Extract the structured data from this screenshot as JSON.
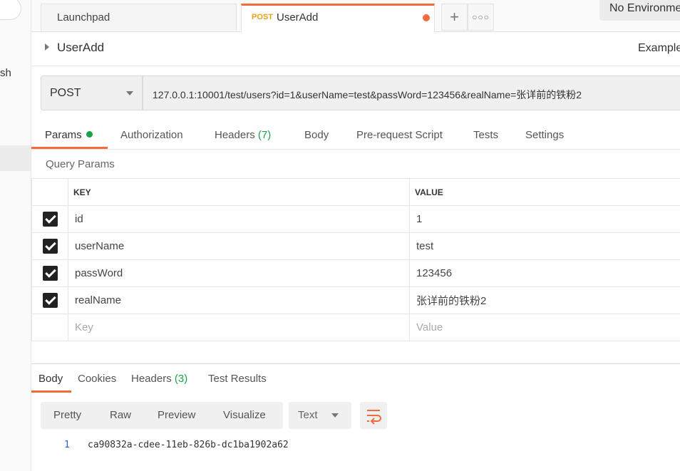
{
  "sidebar": {
    "partial_label": "sh"
  },
  "tabs": [
    {
      "label": "Launchpad"
    },
    {
      "method": "POST",
      "label": "UserAdd"
    }
  ],
  "environment": {
    "label": "No Environme"
  },
  "request": {
    "name": "UserAdd",
    "examples_label": "Example",
    "method": "POST",
    "url": "127.0.0.1:10001/test/users?id=1&userName=test&passWord=123456&realName=张详前的铁粉2"
  },
  "request_tabs": {
    "params": "Params",
    "authorization": "Authorization",
    "headers": "Headers",
    "headers_count": "(7)",
    "body": "Body",
    "prerequest": "Pre-request Script",
    "tests": "Tests",
    "settings": "Settings"
  },
  "query_params": {
    "title": "Query Params",
    "col_key": "KEY",
    "col_value": "VALUE",
    "rows": [
      {
        "key": "id",
        "value": "1",
        "checked": true
      },
      {
        "key": "userName",
        "value": "test",
        "checked": true
      },
      {
        "key": "passWord",
        "value": "123456",
        "checked": true
      },
      {
        "key": "realName",
        "value": "张详前的铁粉2",
        "checked": true
      }
    ],
    "key_placeholder": "Key",
    "value_placeholder": "Value"
  },
  "response": {
    "tabs": {
      "body": "Body",
      "cookies": "Cookies",
      "headers": "Headers",
      "headers_count": "(3)",
      "test_results": "Test Results"
    },
    "formats": [
      "Pretty",
      "Raw",
      "Preview",
      "Visualize"
    ],
    "content_type": "Text",
    "line_number": "1",
    "body": "ca90832a-cdee-11eb-826b-dc1ba1902a62"
  },
  "colors": {
    "accent": "#f26b3a",
    "green": "#1aa24a",
    "method_orange": "#e8a317"
  }
}
